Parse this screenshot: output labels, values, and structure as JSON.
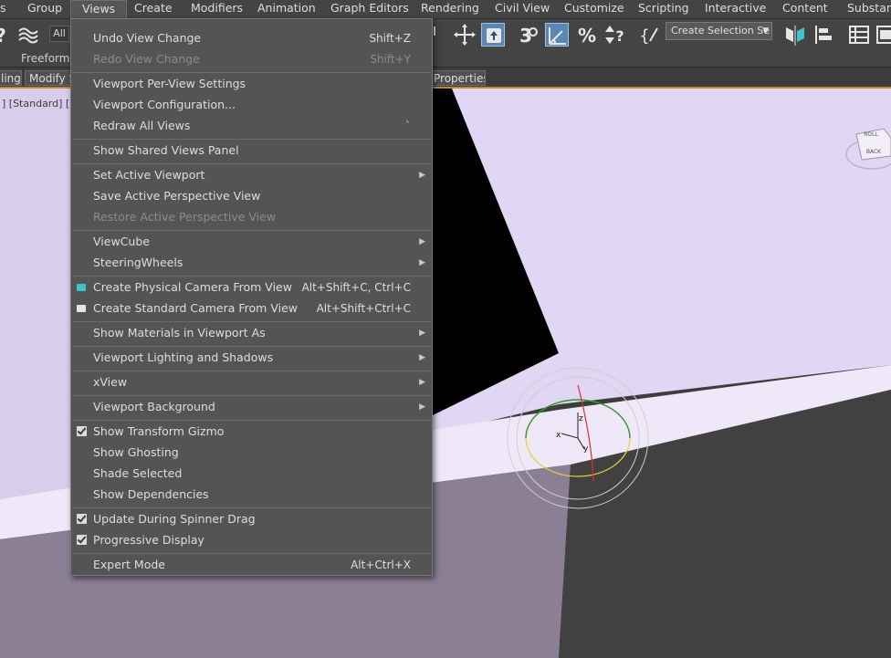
{
  "menubar": {
    "items": [
      "s",
      "Group",
      "Views",
      "Create",
      "Modifiers",
      "Animation",
      "Graph Editors",
      "Rendering",
      "Civil View",
      "Customize",
      "Scripting",
      "Interactive",
      "Content",
      "Substance"
    ]
  },
  "toolbar": {
    "filter_label": "All",
    "selection_set_placeholder": "Create Selection Se",
    "icons": [
      "help-icon",
      "bind-space-warp-icon",
      "select-and-move-icon",
      "select-and-place-icon",
      "snaps-toggle-icon",
      "angle-snap-icon",
      "percent-snap-icon",
      "spinner-snap-icon",
      "edit-named-selection-icon",
      "mirror-icon",
      "align-icon",
      "scene-explorer-icon",
      "layer-explorer-icon"
    ]
  },
  "ribbon": {
    "label": "Freeform",
    "tabs": [
      "ling",
      "Modify S",
      "Properties"
    ]
  },
  "viewport": {
    "label": "] [Standard] [E",
    "viewcube": {
      "top": "ROLL",
      "face": "BACK"
    },
    "gizmo": {
      "x": "x",
      "y": "y",
      "z": "z"
    },
    "colors": {
      "lavender": "#e1d6f3",
      "lavender_dark": "#d2c6e6",
      "shadow": "#8a7f94",
      "black": "#000000",
      "grey": "#3d3d3d"
    }
  },
  "views_menu": {
    "items": [
      {
        "label": "Undo View Change",
        "shortcut": "Shift+Z"
      },
      {
        "label": "Redo View Change",
        "shortcut": "Shift+Y",
        "disabled": true
      },
      {
        "label": "Viewport Per-View Settings"
      },
      {
        "label": "Viewport Configuration..."
      },
      {
        "label": "Redraw All Views",
        "shortcut": "`"
      },
      {
        "label": "Show Shared Views Panel"
      },
      {
        "label": "Set Active Viewport",
        "submenu": true
      },
      {
        "label": "Save Active Perspective View"
      },
      {
        "label": "Restore Active Perspective View",
        "disabled": true
      },
      {
        "label": "ViewCube",
        "submenu": true
      },
      {
        "label": "SteeringWheels",
        "submenu": true
      },
      {
        "label": "Create Physical Camera From View",
        "shortcut": "Alt+Shift+C, Ctrl+C",
        "icon": "physical-camera-icon"
      },
      {
        "label": "Create Standard Camera From View",
        "shortcut": "Alt+Shift+Ctrl+C",
        "icon": "standard-camera-icon"
      },
      {
        "label": "Show Materials in Viewport As",
        "submenu": true
      },
      {
        "label": "Viewport Lighting and Shadows",
        "submenu": true
      },
      {
        "label": "xView",
        "submenu": true
      },
      {
        "label": "Viewport Background",
        "submenu": true
      },
      {
        "label": "Show Transform Gizmo",
        "checked": true
      },
      {
        "label": "Show Ghosting"
      },
      {
        "label": "Shade Selected"
      },
      {
        "label": "Show Dependencies"
      },
      {
        "label": "Update During Spinner Drag",
        "checked": true
      },
      {
        "label": "Progressive Display",
        "checked": true
      },
      {
        "label": "Expert Mode",
        "shortcut": "Alt+Ctrl+X"
      }
    ],
    "colors": {
      "menu_bg": "#545454",
      "physical_camera": "#3ec6c6",
      "standard_camera": "#e6e6e6"
    }
  }
}
